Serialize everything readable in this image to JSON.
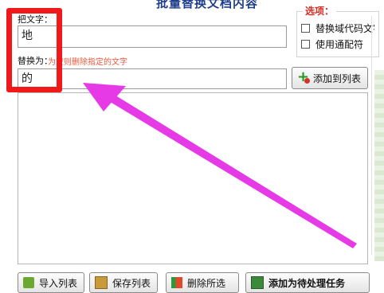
{
  "window": {
    "title": "批量替换文档内容"
  },
  "find": {
    "label": "把文字：",
    "value": "地"
  },
  "replace": {
    "label": "替换为：",
    "value": "的",
    "hint": "为空则删除指定的文字"
  },
  "options": {
    "title": "选项：",
    "items": [
      {
        "label": "替换域代码文字",
        "checked": false
      },
      {
        "label": "使用通配符",
        "checked": false
      }
    ]
  },
  "buttons": {
    "add_to_list": "添加到列表",
    "import_list": "导入列表",
    "save_list": "保存列表",
    "delete_selected": "删除所选",
    "add_task": "添加为待处理任务"
  },
  "colors": {
    "highlight_box": "#f01818",
    "arrow": "#e63ae6",
    "title": "#1f3f8a",
    "hint": "#e8583c",
    "legend": "#d62b1e"
  },
  "icons": {
    "add_to_list": "green-plus-icon",
    "import_list": "import-icon",
    "save_list": "save-icon",
    "delete_selected": "delete-icon",
    "add_task": "add-task-icon"
  }
}
